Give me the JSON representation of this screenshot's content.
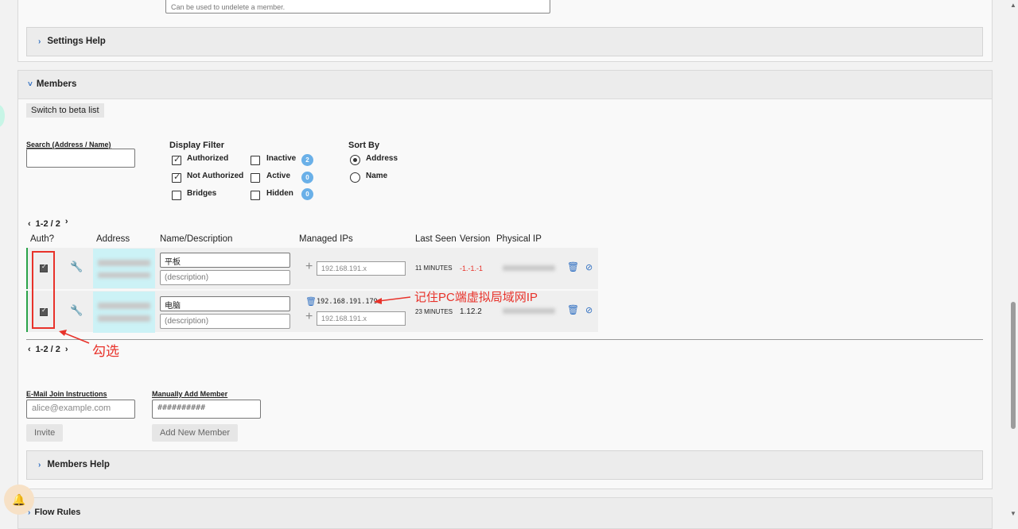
{
  "settings": {
    "undelete_note": "Can be used to undelete a member.",
    "help_label": "Settings Help"
  },
  "members": {
    "title": "Members",
    "switch_beta": "Switch to beta list",
    "search_label": "Search (Address / Name)",
    "search_value": "",
    "display_filter": {
      "title": "Display Filter",
      "authorized": "Authorized",
      "not_authorized": "Not Authorized",
      "bridges": "Bridges",
      "inactive": "Inactive",
      "active": "Active",
      "hidden": "Hidden",
      "inactive_count": "2",
      "active_count": "0",
      "hidden_count": "0"
    },
    "sort_by": {
      "title": "Sort By",
      "address": "Address",
      "name": "Name"
    },
    "pager": "1-2 / 2",
    "columns": {
      "auth": "Auth?",
      "address": "Address",
      "name": "Name/Description",
      "managed_ips": "Managed IPs",
      "last_seen": "Last Seen",
      "version": "Version",
      "physical_ip": "Physical IP"
    },
    "rows": [
      {
        "name": "平板",
        "description_placeholder": "(description)",
        "ip_placeholder": "192.168.191.x",
        "last_seen": "11 MINUTES",
        "version": "-1.-1.-1",
        "version_color": "#e8322a"
      },
      {
        "name": "电脑",
        "description_placeholder": "(description)",
        "assigned_ip": "192.168.191.179",
        "ip_placeholder": "192.168.191.x",
        "last_seen": "23 MINUTES",
        "version": "1.12.2"
      }
    ],
    "email_label": "E-Mail Join Instructions",
    "email_placeholder": "alice@example.com",
    "invite_label": "Invite",
    "manual_label": "Manually Add Member",
    "manual_placeholder": "##########",
    "add_member_label": "Add New Member",
    "help_label": "Members Help"
  },
  "flow_rules": {
    "title": "Flow Rules"
  },
  "annotations": {
    "ip_note": "记住PC端虚拟局域网IP",
    "check_note": "勾选"
  },
  "colors": {
    "accent": "#2f6fc2",
    "annotation": "#e8322a",
    "online": "#2aa34a"
  }
}
